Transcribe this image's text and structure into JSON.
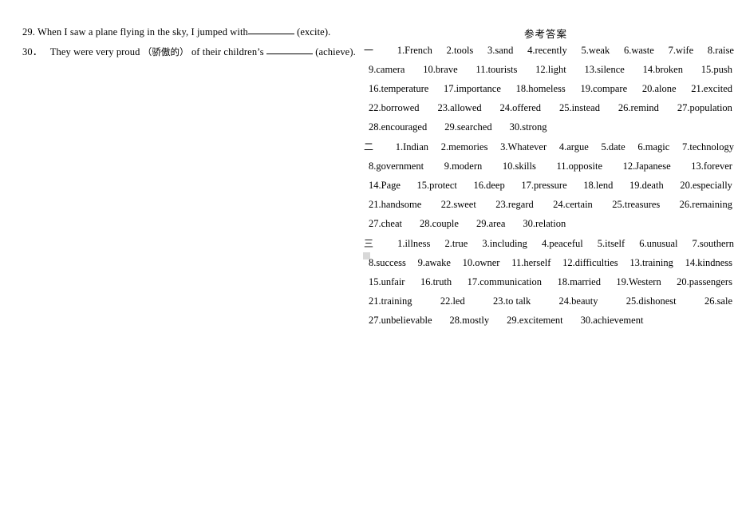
{
  "document": {
    "title_cn": "参考答案"
  },
  "questions": [
    {
      "number": "29.",
      "text_before": "When I saw a plane flying in the sky, I jumped with",
      "blank": "__________",
      "text_after": "(excite)."
    },
    {
      "number": "30．",
      "text_before": "They were very proud",
      "paren_cn": "（骄傲的）",
      "text_mid": "of their children’s",
      "blank": "__________",
      "text_after": "(achieve)."
    }
  ],
  "answer_key": {
    "sections": [
      {
        "marker": "一",
        "rows": [
          [
            "1.French",
            "2.tools",
            "3.sand",
            "4.recently",
            "5.weak",
            "6.waste",
            "7.wife",
            "8.raise"
          ],
          [
            "9.camera",
            "10.brave",
            "11.tourists",
            "12.light",
            "13.silence",
            "14.broken",
            "15.push"
          ],
          [
            "16.temperature",
            "17.importance",
            "18.homeless",
            "19.compare",
            "20.alone",
            "21.excited"
          ],
          [
            "22.borrowed",
            "23.allowed",
            "24.offered",
            "25.instead",
            "26.remind",
            "27.population"
          ],
          [
            "28.encouraged",
            "29.searched",
            "30.strong"
          ]
        ]
      },
      {
        "marker": "二",
        "rows": [
          [
            "1.Indian",
            "2.memories",
            "3.Whatever",
            "4.argue",
            "5.date",
            "6.magic",
            "7.technology"
          ],
          [
            "8.government",
            "9.modern",
            "10.skills",
            "11.opposite",
            "12.Japanese",
            "13.forever"
          ],
          [
            "14.Page",
            "15.protect",
            "16.deep",
            "17.pressure",
            "18.lend",
            "19.death",
            "20.especially"
          ],
          [
            "21.handsome",
            "22.sweet",
            "23.regard",
            "24.certain",
            "25.treasures",
            "26.remaining"
          ],
          [
            "27.cheat",
            "28.couple",
            "29.area",
            "30.relation"
          ]
        ]
      },
      {
        "marker": "三",
        "rows": [
          [
            "1.illness",
            "2.true",
            "3.including",
            "4.peaceful",
            "5.itself",
            "6.unusual",
            "7.southern"
          ],
          [
            "8.success",
            "9.awake",
            "10.owner",
            "11.herself",
            "12.difficulties",
            "13.training",
            "14.kindness"
          ],
          [
            "15.unfair",
            "16.truth",
            "17.communication",
            "18.married",
            "19.Western",
            "20.passengers"
          ],
          [
            "21.training",
            "22.led",
            "23.to   talk",
            "24.beauty",
            "25.dishonest",
            "26.sale"
          ],
          [
            "27.unbelievable",
            "28.mostly",
            "29.excitement",
            "30.achievement"
          ]
        ]
      }
    ]
  },
  "artifacts": {
    "gray_box_color": "#d8d8d8"
  }
}
